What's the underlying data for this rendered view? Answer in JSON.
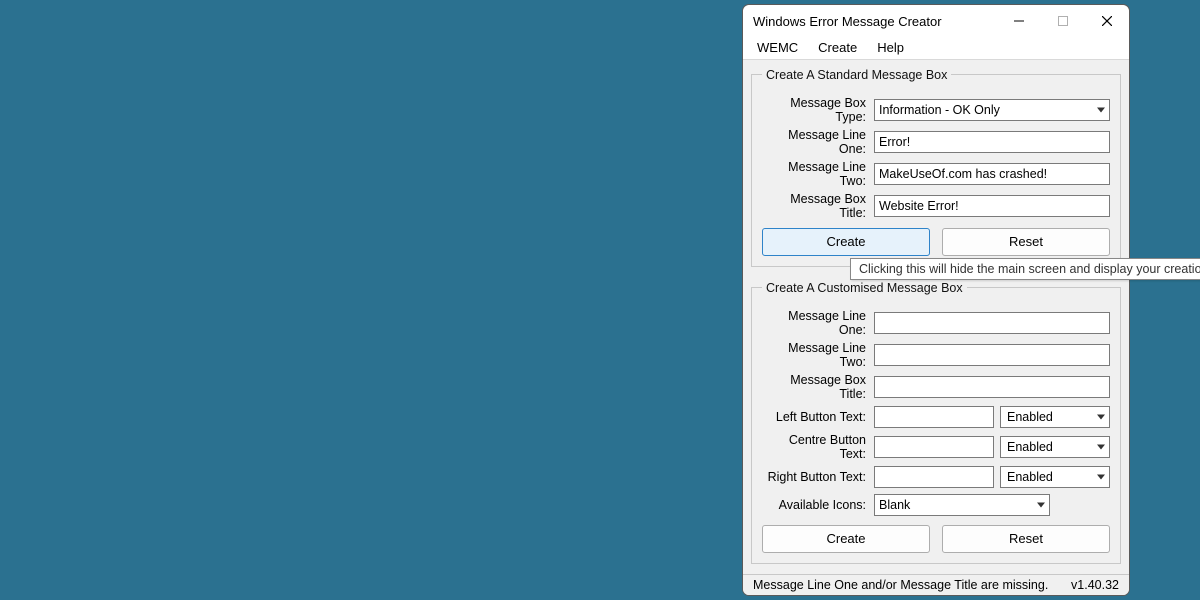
{
  "window": {
    "title": "Windows Error Message Creator"
  },
  "menu": {
    "items": [
      "WEMC",
      "Create",
      "Help"
    ]
  },
  "standard": {
    "legend": "Create A Standard Message Box",
    "labels": {
      "type": "Message Box Type:",
      "line1": "Message Line One:",
      "line2": "Message Line Two:",
      "title": "Message Box Title:"
    },
    "type_value": "Information - OK Only",
    "line1_value": "Error!",
    "line2_value": "MakeUseOf.com has crashed!",
    "title_value": "Website Error!",
    "create_label": "Create",
    "reset_label": "Reset"
  },
  "tooltip": "Clicking this will hide the main screen and display your creation.",
  "custom": {
    "legend": "Create A Customised Message Box",
    "labels": {
      "line1": "Message Line One:",
      "line2": "Message Line Two:",
      "title": "Message Box Title:",
      "left": "Left Button Text:",
      "centre": "Centre Button Text:",
      "right": "Right Button Text:",
      "icons": "Available Icons:"
    },
    "line1_value": "",
    "line2_value": "",
    "title_value": "",
    "left_value": "",
    "centre_value": "",
    "right_value": "",
    "left_state": "Enabled",
    "centre_state": "Enabled",
    "right_state": "Enabled",
    "icons_value": "Blank",
    "create_label": "Create",
    "reset_label": "Reset"
  },
  "status": {
    "message": "Message Line One and/or Message Title are missing.",
    "version": "v1.40.32"
  }
}
